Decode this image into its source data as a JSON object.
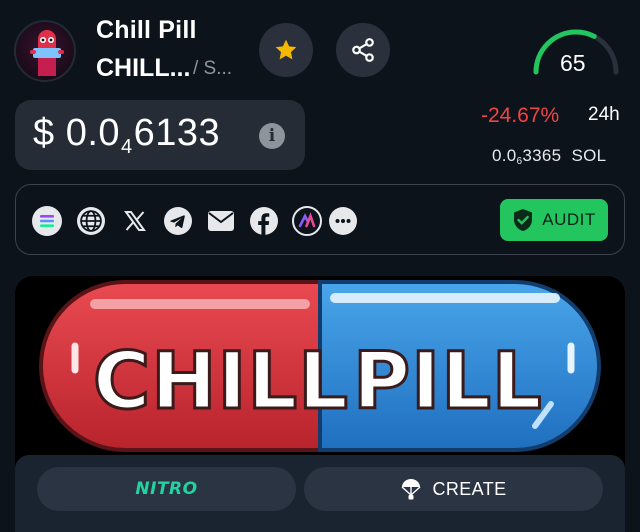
{
  "token": {
    "name": "Chill Pill",
    "symbol": "CHILL...",
    "chain": "/ S...",
    "logo_icon": "chill-pill-logo"
  },
  "header": {
    "favorite_icon": "star-icon",
    "share_icon": "share-icon",
    "score": "65",
    "score_fraction": 0.65
  },
  "price": {
    "prefix": "$ 0.0",
    "zeros": "4",
    "digits": "6133",
    "change": "-24.67%",
    "period": "24h",
    "sol_prefix": "0.0",
    "sol_zeros": "6",
    "sol_digits": "3365",
    "sol_unit": "SOL"
  },
  "links": {
    "icons": [
      "solana-icon",
      "globe-icon",
      "x-icon",
      "telegram-icon",
      "mail-icon",
      "facebook-icon",
      "app-logo-icon",
      "more-icon"
    ],
    "audit_label": "AUDIT"
  },
  "banner": {
    "word_left": "CHILL",
    "word_right": "PILL"
  },
  "bottom": {
    "nitro_label": "NITRO",
    "create_label": "CREATE"
  },
  "colors": {
    "background": "#0d131b",
    "card": "#252c36",
    "accent_green": "#22c55e",
    "negative": "#ef4444",
    "star": "#f5b700",
    "nitro": "#22d3a0"
  }
}
